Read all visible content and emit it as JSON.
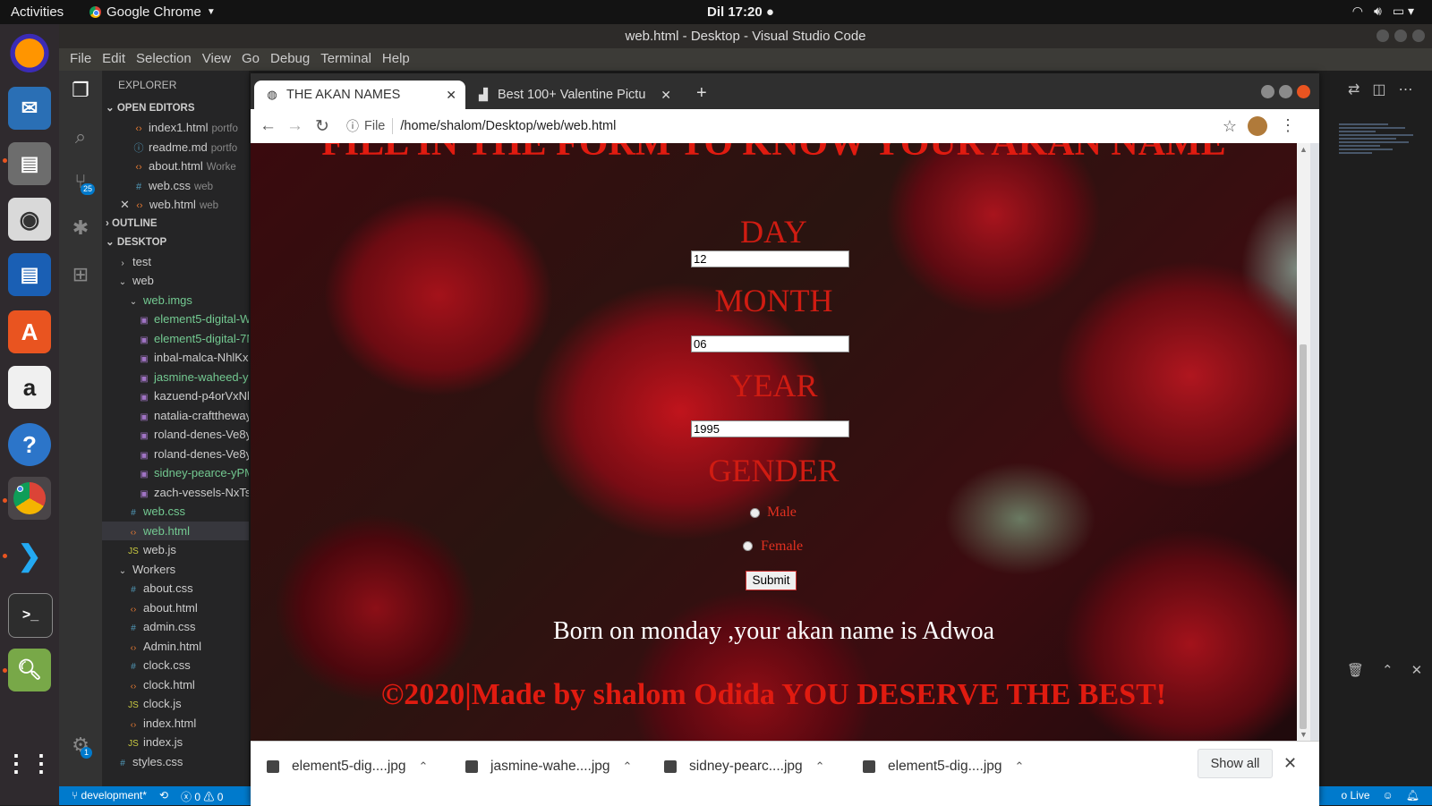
{
  "topbar": {
    "activities": "Activities",
    "app_name": "Google Chrome",
    "clock": "Dil 17:20"
  },
  "vscode": {
    "title": "web.html - Desktop - Visual Studio Code",
    "menu": [
      "File",
      "Edit",
      "Selection",
      "View",
      "Go",
      "Debug",
      "Terminal",
      "Help"
    ],
    "scm_badge": "25",
    "settings_badge": "1",
    "explorer": {
      "header": "EXPLORER",
      "open_editors_label": "OPEN EDITORS",
      "open_editors": [
        {
          "name": "index1.html",
          "desc": "portfo"
        },
        {
          "name": "readme.md",
          "desc": "portfo"
        },
        {
          "name": "about.html",
          "desc": "Worke"
        },
        {
          "name": "web.css",
          "desc": "web"
        },
        {
          "name": "web.html",
          "desc": "web"
        }
      ],
      "outline_label": "OUTLINE",
      "desktop_label": "DESKTOP",
      "tree": [
        {
          "name": "test",
          "type": "folder-closed",
          "indent": 1
        },
        {
          "name": "web",
          "type": "folder-open",
          "indent": 1
        },
        {
          "name": "web.imgs",
          "type": "folder-open",
          "indent": 2
        },
        {
          "name": "element5-digital-W",
          "type": "img",
          "indent": 3
        },
        {
          "name": "element5-digital-7N",
          "type": "img",
          "indent": 3
        },
        {
          "name": "inbal-malca-NhlKx6",
          "type": "img",
          "indent": 3
        },
        {
          "name": "jasmine-waheed-yH",
          "type": "img",
          "indent": 3
        },
        {
          "name": "kazuend-p4orVxNl5",
          "type": "img",
          "indent": 3
        },
        {
          "name": "natalia-crafttheway",
          "type": "img",
          "indent": 3
        },
        {
          "name": "roland-denes-Ve8yy",
          "type": "img",
          "indent": 3
        },
        {
          "name": "roland-denes-Ve8yy",
          "type": "img",
          "indent": 3
        },
        {
          "name": "sidney-pearce-yPM",
          "type": "img",
          "indent": 3
        },
        {
          "name": "zach-vessels-NxTs_(",
          "type": "img",
          "indent": 3
        },
        {
          "name": "web.css",
          "type": "css",
          "indent": 2
        },
        {
          "name": "web.html",
          "type": "html",
          "indent": 2,
          "selected": true
        },
        {
          "name": "web.js",
          "type": "js",
          "indent": 2
        },
        {
          "name": "Workers",
          "type": "folder-open",
          "indent": 1
        },
        {
          "name": "about.css",
          "type": "css",
          "indent": 2
        },
        {
          "name": "about.html",
          "type": "html",
          "indent": 2
        },
        {
          "name": "admin.css",
          "type": "css",
          "indent": 2
        },
        {
          "name": "Admin.html",
          "type": "html",
          "indent": 2
        },
        {
          "name": "clock.css",
          "type": "css",
          "indent": 2
        },
        {
          "name": "clock.html",
          "type": "html",
          "indent": 2
        },
        {
          "name": "clock.js",
          "type": "js",
          "indent": 2
        },
        {
          "name": "index.html",
          "type": "html",
          "indent": 2
        },
        {
          "name": "index.js",
          "type": "js",
          "indent": 2
        },
        {
          "name": "styles.css",
          "type": "css",
          "indent": 1
        }
      ]
    },
    "status": {
      "branch": "development*",
      "errors": "0",
      "warnings": "0",
      "live": "o Live"
    }
  },
  "chrome": {
    "tabs": [
      {
        "title": "THE AKAN NAMES",
        "active": true
      },
      {
        "title": "Best 100+ Valentine Pictu",
        "active": false
      }
    ],
    "omnibox": {
      "scheme": "File",
      "url": "/home/shalom/Desktop/web/web.html"
    },
    "page": {
      "heading": "FILL IN THE FORM TO KNOW YOUR AKAN NAME",
      "day_label": "DAY",
      "day_value": "12",
      "month_label": "MONTH",
      "month_value": "06",
      "year_label": "YEAR",
      "year_value": "1995",
      "gender_label": "GENDER",
      "male_label": "Male",
      "female_label": "Female",
      "submit_label": "Submit",
      "result": "Born on monday ,your akan name is Adwoa",
      "footer": "©2020|Made by shalom Odida YOU DESERVE THE BEST!"
    },
    "downloads": [
      {
        "name": "element5-dig....jpg"
      },
      {
        "name": "jasmine-wahe....jpg"
      },
      {
        "name": "sidney-pearc....jpg"
      },
      {
        "name": "element5-dig....jpg"
      }
    ],
    "show_all": "Show all"
  }
}
